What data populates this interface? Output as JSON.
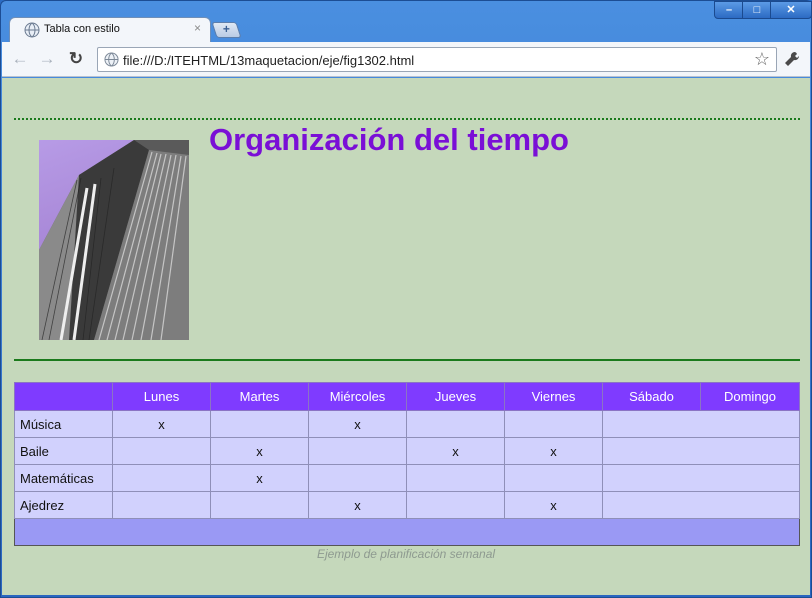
{
  "browser": {
    "tab_title": "Tabla con estilo",
    "tab_close": "×",
    "new_tab": "+",
    "url": "file:///D:/ITEHTML/13maquetacion/eje/fig1302.html",
    "window_controls": {
      "minimize": "–",
      "maximize": "□",
      "close": "✕"
    },
    "nav": {
      "back": "←",
      "forward": "→",
      "reload": "↻",
      "star": "☆",
      "wrench": "🔧"
    }
  },
  "page": {
    "heading": "Organización del tiempo",
    "table": {
      "headers": [
        "",
        "Lunes",
        "Martes",
        "Miércoles",
        "Jueves",
        "Viernes",
        "Sábado",
        "Domingo"
      ],
      "rows": [
        [
          "Música",
          "x",
          "",
          "x",
          "",
          "",
          "",
          ""
        ],
        [
          "Baile",
          "",
          "x",
          "",
          "x",
          "x",
          "",
          ""
        ],
        [
          "Matemáticas",
          "",
          "x",
          "",
          "",
          "",
          "",
          ""
        ],
        [
          "Ajedrez",
          "",
          "",
          "x",
          "",
          "x",
          "",
          ""
        ]
      ],
      "caption": "Ejemplo de planificación semanal"
    },
    "colors": {
      "background": "#c5d8bb",
      "heading": "#7a0fd6",
      "header_row": "#7f3bff",
      "cell": "#d1d1fd",
      "footer_row": "#9a99f4",
      "rule": "#1b7a1b"
    }
  }
}
